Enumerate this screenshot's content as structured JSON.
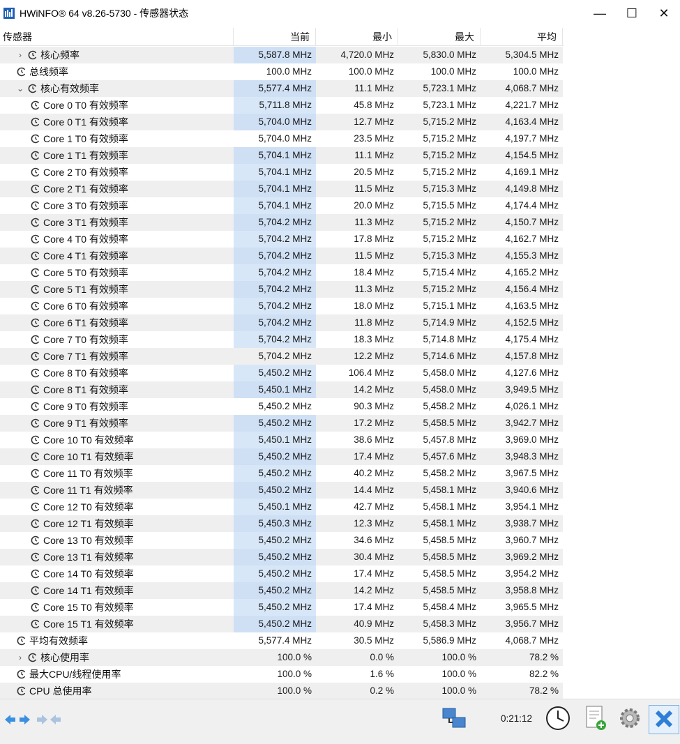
{
  "window": {
    "title": "HWiNFO® 64 v8.26-5730 - 传感器状态",
    "minimize_label": "—",
    "maximize_label": "☐",
    "close_label": "✕"
  },
  "columns": {
    "sensor": "传感器",
    "current": "当前",
    "min": "最小",
    "max": "最大",
    "avg": "平均"
  },
  "rows": [
    {
      "indent": 1,
      "expander": "›",
      "label": "核心频率",
      "current": "5,587.8 MHz",
      "min": "4,720.0 MHz",
      "max": "5,830.0 MHz",
      "avg": "5,304.5 MHz",
      "hl": true,
      "shade": true
    },
    {
      "indent": 0,
      "expander": "",
      "label": "总线频率",
      "current": "100.0 MHz",
      "min": "100.0 MHz",
      "max": "100.0 MHz",
      "avg": "100.0 MHz",
      "hl": false,
      "shade": false
    },
    {
      "indent": 1,
      "expander": "⌄",
      "label": "核心有效频率",
      "current": "5,577.4 MHz",
      "min": "11.1 MHz",
      "max": "5,723.1 MHz",
      "avg": "4,068.7 MHz",
      "hl": true,
      "shade": true
    },
    {
      "indent": 2,
      "expander": "",
      "label": "Core 0 T0 有效频率",
      "current": "5,711.8 MHz",
      "min": "45.8 MHz",
      "max": "5,723.1 MHz",
      "avg": "4,221.7 MHz",
      "hl": true,
      "shade": false
    },
    {
      "indent": 2,
      "expander": "",
      "label": "Core 0 T1 有效频率",
      "current": "5,704.0 MHz",
      "min": "12.7 MHz",
      "max": "5,715.2 MHz",
      "avg": "4,163.4 MHz",
      "hl": true,
      "shade": true
    },
    {
      "indent": 2,
      "expander": "",
      "label": "Core 1 T0 有效频率",
      "current": "5,704.0 MHz",
      "min": "23.5 MHz",
      "max": "5,715.2 MHz",
      "avg": "4,197.7 MHz",
      "hl": false,
      "shade": false
    },
    {
      "indent": 2,
      "expander": "",
      "label": "Core 1 T1 有效频率",
      "current": "5,704.1 MHz",
      "min": "11.1 MHz",
      "max": "5,715.2 MHz",
      "avg": "4,154.5 MHz",
      "hl": true,
      "shade": true
    },
    {
      "indent": 2,
      "expander": "",
      "label": "Core 2 T0 有效频率",
      "current": "5,704.1 MHz",
      "min": "20.5 MHz",
      "max": "5,715.2 MHz",
      "avg": "4,169.1 MHz",
      "hl": true,
      "shade": false
    },
    {
      "indent": 2,
      "expander": "",
      "label": "Core 2 T1 有效频率",
      "current": "5,704.1 MHz",
      "min": "11.5 MHz",
      "max": "5,715.3 MHz",
      "avg": "4,149.8 MHz",
      "hl": true,
      "shade": true
    },
    {
      "indent": 2,
      "expander": "",
      "label": "Core 3 T0 有效频率",
      "current": "5,704.1 MHz",
      "min": "20.0 MHz",
      "max": "5,715.5 MHz",
      "avg": "4,174.4 MHz",
      "hl": true,
      "shade": false
    },
    {
      "indent": 2,
      "expander": "",
      "label": "Core 3 T1 有效频率",
      "current": "5,704.2 MHz",
      "min": "11.3 MHz",
      "max": "5,715.2 MHz",
      "avg": "4,150.7 MHz",
      "hl": true,
      "shade": true
    },
    {
      "indent": 2,
      "expander": "",
      "label": "Core 4 T0 有效频率",
      "current": "5,704.2 MHz",
      "min": "17.8 MHz",
      "max": "5,715.2 MHz",
      "avg": "4,162.7 MHz",
      "hl": true,
      "shade": false
    },
    {
      "indent": 2,
      "expander": "",
      "label": "Core 4 T1 有效频率",
      "current": "5,704.2 MHz",
      "min": "11.5 MHz",
      "max": "5,715.3 MHz",
      "avg": "4,155.3 MHz",
      "hl": true,
      "shade": true
    },
    {
      "indent": 2,
      "expander": "",
      "label": "Core 5 T0 有效频率",
      "current": "5,704.2 MHz",
      "min": "18.4 MHz",
      "max": "5,715.4 MHz",
      "avg": "4,165.2 MHz",
      "hl": true,
      "shade": false
    },
    {
      "indent": 2,
      "expander": "",
      "label": "Core 5 T1 有效频率",
      "current": "5,704.2 MHz",
      "min": "11.3 MHz",
      "max": "5,715.2 MHz",
      "avg": "4,156.4 MHz",
      "hl": true,
      "shade": true
    },
    {
      "indent": 2,
      "expander": "",
      "label": "Core 6 T0 有效频率",
      "current": "5,704.2 MHz",
      "min": "18.0 MHz",
      "max": "5,715.1 MHz",
      "avg": "4,163.5 MHz",
      "hl": true,
      "shade": false
    },
    {
      "indent": 2,
      "expander": "",
      "label": "Core 6 T1 有效频率",
      "current": "5,704.2 MHz",
      "min": "11.8 MHz",
      "max": "5,714.9 MHz",
      "avg": "4,152.5 MHz",
      "hl": true,
      "shade": true
    },
    {
      "indent": 2,
      "expander": "",
      "label": "Core 7 T0 有效频率",
      "current": "5,704.2 MHz",
      "min": "18.3 MHz",
      "max": "5,714.8 MHz",
      "avg": "4,175.4 MHz",
      "hl": true,
      "shade": false
    },
    {
      "indent": 2,
      "expander": "",
      "label": "Core 7 T1 有效频率",
      "current": "5,704.2 MHz",
      "min": "12.2 MHz",
      "max": "5,714.6 MHz",
      "avg": "4,157.8 MHz",
      "hl": false,
      "shade": true
    },
    {
      "indent": 2,
      "expander": "",
      "label": "Core 8 T0 有效频率",
      "current": "5,450.2 MHz",
      "min": "106.4 MHz",
      "max": "5,458.0 MHz",
      "avg": "4,127.6 MHz",
      "hl": true,
      "shade": false
    },
    {
      "indent": 2,
      "expander": "",
      "label": "Core 8 T1 有效频率",
      "current": "5,450.1 MHz",
      "min": "14.2 MHz",
      "max": "5,458.0 MHz",
      "avg": "3,949.5 MHz",
      "hl": true,
      "shade": true
    },
    {
      "indent": 2,
      "expander": "",
      "label": "Core 9 T0 有效频率",
      "current": "5,450.2 MHz",
      "min": "90.3 MHz",
      "max": "5,458.2 MHz",
      "avg": "4,026.1 MHz",
      "hl": false,
      "shade": false
    },
    {
      "indent": 2,
      "expander": "",
      "label": "Core 9 T1 有效频率",
      "current": "5,450.2 MHz",
      "min": "17.2 MHz",
      "max": "5,458.5 MHz",
      "avg": "3,942.7 MHz",
      "hl": true,
      "shade": true
    },
    {
      "indent": 2,
      "expander": "",
      "label": "Core 10 T0 有效频率",
      "current": "5,450.1 MHz",
      "min": "38.6 MHz",
      "max": "5,457.8 MHz",
      "avg": "3,969.0 MHz",
      "hl": true,
      "shade": false
    },
    {
      "indent": 2,
      "expander": "",
      "label": "Core 10 T1 有效频率",
      "current": "5,450.2 MHz",
      "min": "17.4 MHz",
      "max": "5,457.6 MHz",
      "avg": "3,948.3 MHz",
      "hl": true,
      "shade": true
    },
    {
      "indent": 2,
      "expander": "",
      "label": "Core 11 T0 有效频率",
      "current": "5,450.2 MHz",
      "min": "40.2 MHz",
      "max": "5,458.2 MHz",
      "avg": "3,967.5 MHz",
      "hl": true,
      "shade": false
    },
    {
      "indent": 2,
      "expander": "",
      "label": "Core 11 T1 有效频率",
      "current": "5,450.2 MHz",
      "min": "14.4 MHz",
      "max": "5,458.1 MHz",
      "avg": "3,940.6 MHz",
      "hl": true,
      "shade": true
    },
    {
      "indent": 2,
      "expander": "",
      "label": "Core 12 T0 有效频率",
      "current": "5,450.1 MHz",
      "min": "42.7 MHz",
      "max": "5,458.1 MHz",
      "avg": "3,954.1 MHz",
      "hl": true,
      "shade": false
    },
    {
      "indent": 2,
      "expander": "",
      "label": "Core 12 T1 有效频率",
      "current": "5,450.3 MHz",
      "min": "12.3 MHz",
      "max": "5,458.1 MHz",
      "avg": "3,938.7 MHz",
      "hl": true,
      "shade": true
    },
    {
      "indent": 2,
      "expander": "",
      "label": "Core 13 T0 有效频率",
      "current": "5,450.2 MHz",
      "min": "34.6 MHz",
      "max": "5,458.5 MHz",
      "avg": "3,960.7 MHz",
      "hl": true,
      "shade": false
    },
    {
      "indent": 2,
      "expander": "",
      "label": "Core 13 T1 有效频率",
      "current": "5,450.2 MHz",
      "min": "30.4 MHz",
      "max": "5,458.5 MHz",
      "avg": "3,969.2 MHz",
      "hl": true,
      "shade": true
    },
    {
      "indent": 2,
      "expander": "",
      "label": "Core 14 T0 有效频率",
      "current": "5,450.2 MHz",
      "min": "17.4 MHz",
      "max": "5,458.5 MHz",
      "avg": "3,954.2 MHz",
      "hl": true,
      "shade": false
    },
    {
      "indent": 2,
      "expander": "",
      "label": "Core 14 T1 有效频率",
      "current": "5,450.2 MHz",
      "min": "14.2 MHz",
      "max": "5,458.5 MHz",
      "avg": "3,958.8 MHz",
      "hl": true,
      "shade": true
    },
    {
      "indent": 2,
      "expander": "",
      "label": "Core 15 T0 有效频率",
      "current": "5,450.2 MHz",
      "min": "17.4 MHz",
      "max": "5,458.4 MHz",
      "avg": "3,965.5 MHz",
      "hl": true,
      "shade": false
    },
    {
      "indent": 2,
      "expander": "",
      "label": "Core 15 T1 有效频率",
      "current": "5,450.2 MHz",
      "min": "40.9 MHz",
      "max": "5,458.3 MHz",
      "avg": "3,956.7 MHz",
      "hl": true,
      "shade": true
    },
    {
      "indent": 0,
      "expander": "",
      "label": "平均有效频率",
      "current": "5,577.4 MHz",
      "min": "30.5 MHz",
      "max": "5,586.9 MHz",
      "avg": "4,068.7 MHz",
      "hl": false,
      "shade": false
    },
    {
      "indent": 1,
      "expander": "›",
      "label": "核心使用率",
      "current": "100.0 %",
      "min": "0.0 %",
      "max": "100.0 %",
      "avg": "78.2 %",
      "hl": false,
      "shade": true
    },
    {
      "indent": 0,
      "expander": "",
      "label": "最大CPU/线程使用率",
      "current": "100.0 %",
      "min": "1.6 %",
      "max": "100.0 %",
      "avg": "82.2 %",
      "hl": false,
      "shade": false
    },
    {
      "indent": 0,
      "expander": "",
      "label": "CPU 总使用率",
      "current": "100.0 %",
      "min": "0.2 %",
      "max": "100.0 %",
      "avg": "78.2 %",
      "hl": false,
      "shade": true
    }
  ],
  "toolbar": {
    "timer": "0:21:12",
    "icons": [
      "nav-left-right-icon",
      "nav-collapse-icon",
      "network-icon",
      "clock-icon",
      "report-add-icon",
      "settings-gear-icon",
      "close-x-icon"
    ]
  },
  "colors": {
    "highlight": "#d8e7f8",
    "shade": "#efefef",
    "close_accent": "#2f7fd6"
  }
}
